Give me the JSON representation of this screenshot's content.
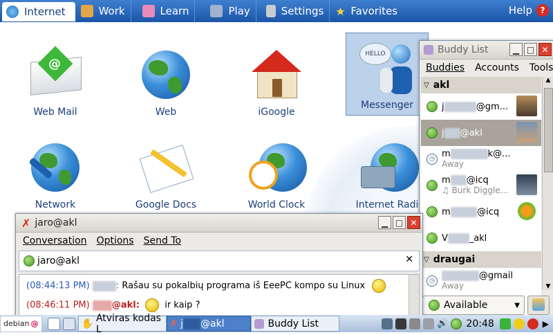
{
  "topbar": {
    "tabs": [
      {
        "label": "Internet",
        "icon": "globe-icon",
        "active": true
      },
      {
        "label": "Work",
        "icon": "briefcase-icon"
      },
      {
        "label": "Learn",
        "icon": "book-icon"
      },
      {
        "label": "Play",
        "icon": "gamepad-icon"
      },
      {
        "label": "Settings",
        "icon": "wrench-icon"
      },
      {
        "label": "Favorites",
        "icon": "star-icon"
      }
    ],
    "help_label": "Help",
    "help_icon": "?"
  },
  "apps": [
    {
      "label": "Web Mail"
    },
    {
      "label": "Web"
    },
    {
      "label": "iGoogle"
    },
    {
      "label": "Messenger"
    },
    {
      "label": "Network"
    },
    {
      "label": "Google Docs"
    },
    {
      "label": "World Clock"
    },
    {
      "label": "Internet Radi"
    }
  ],
  "chat": {
    "title": "jaro@akl",
    "menu": [
      "Conversation",
      "Options",
      "Send To"
    ],
    "header_name": "jaro@akl",
    "messages": [
      {
        "time": "(08:44:13 PM)",
        "sender": "jaro",
        "text": "Rašau su pokalbių programa iš EeePC kompo su Linux"
      },
      {
        "time": "(08:46:11 PM)",
        "sender": "@akl:",
        "text": "ir kaip ?"
      }
    ]
  },
  "buddy": {
    "title": "Buddy List",
    "menu": [
      "Buddies",
      "Accounts",
      "Tools"
    ],
    "groups": [
      {
        "name": "akl",
        "items": [
          {
            "name": "@gm...",
            "prefix": "j",
            "status": "available"
          },
          {
            "name": "@akl",
            "prefix": "j",
            "status": "available",
            "selected": true
          },
          {
            "name": "k@...",
            "prefix": "m",
            "status": "away",
            "sub": "Away"
          },
          {
            "name": "@icq",
            "prefix": "m",
            "status": "available",
            "sub": "♫ Burk Diggle..."
          },
          {
            "name": "@icq",
            "prefix": "m",
            "status": "available"
          },
          {
            "name": "_akl",
            "prefix": "V",
            "status": "available"
          }
        ]
      },
      {
        "name": "draugai",
        "items": [
          {
            "name": "@gmail",
            "prefix": "",
            "status": "away",
            "sub": "Away"
          }
        ]
      }
    ],
    "status_label": "Available"
  },
  "taskbar": {
    "start_label": "debian",
    "items": [
      "Atviras kodas L",
      "@akl",
      "Buddy List"
    ],
    "item2_prefix": "j",
    "clock": "20:48"
  },
  "colors": {
    "topbar": "#1b55a8",
    "accent_text": "#1b3f7a",
    "status_green": "#4c9a23",
    "close_red": "#d9412e"
  }
}
